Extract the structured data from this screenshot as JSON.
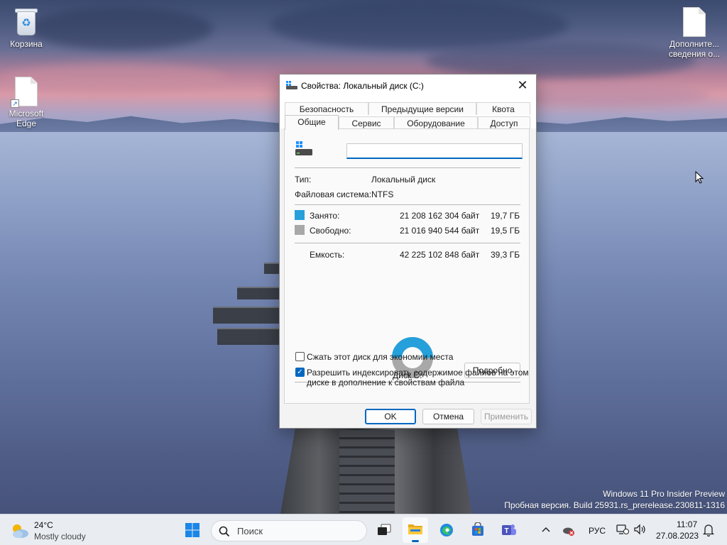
{
  "desktop": {
    "icons": [
      {
        "label": "Корзина",
        "icon": "recycle-bin-icon"
      },
      {
        "label": "Microsoft Edge",
        "icon": "edge-shortcut-icon"
      },
      {
        "label": "Дополните... сведения о...",
        "icon": "document-icon"
      }
    ],
    "watermark": {
      "line1": "Windows 11 Pro Insider Preview",
      "line2": "Пробная версия. Build 25931.rs_prerelease.230811-1316"
    }
  },
  "dialog": {
    "title": "Свойства: Локальный диск (C:)",
    "close_label": "✕",
    "tabs_row1": [
      "Безопасность",
      "Предыдущие версии",
      "Квота"
    ],
    "tabs_row2": [
      "Общие",
      "Сервис",
      "Оборудование",
      "Доступ"
    ],
    "active_tab": "Общие",
    "volume_name": "",
    "type_label": "Тип:",
    "type_value": "Локальный диск",
    "fs_label": "Файловая система:",
    "fs_value": "NTFS",
    "used_label": "Занято:",
    "used_bytes": "21 208 162 304 байт",
    "used_gb": "19,7 ГБ",
    "free_label": "Свободно:",
    "free_bytes": "21 016 940 544 байт",
    "free_gb": "19,5 ГБ",
    "capacity_label": "Емкость:",
    "capacity_bytes": "42 225 102 848 байт",
    "capacity_gb": "39,3 ГБ",
    "disk_label": "Диск C:",
    "details_button": "Подробно",
    "compress_label": "Сжать этот диск для экономии места",
    "compress_checked": false,
    "index_label_line1": "Разрешить индексировать содержимое файлов на этом",
    "index_label_line2": "диске в дополнение к свойствам файла",
    "index_checked": true,
    "ok_button": "OK",
    "cancel_button": "Отмена",
    "apply_button": "Применить",
    "colors": {
      "used": "#26a0da",
      "free": "#a8a8a8",
      "accent": "#0067c0"
    },
    "used_fraction": 0.5023
  },
  "taskbar": {
    "weather_temp": "24°C",
    "weather_desc": "Mostly cloudy",
    "search_placeholder": "Поиск",
    "language": "РУС",
    "time": "11:07",
    "date": "27.08.2023",
    "pinned": [
      "start-icon",
      "task-view-icon",
      "file-explorer-icon",
      "edge-icon",
      "store-icon",
      "teams-icon"
    ]
  }
}
